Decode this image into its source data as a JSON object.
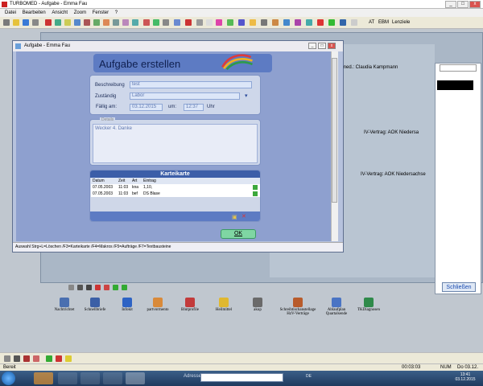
{
  "app": {
    "title": "TURBOMED - Aufgabe - Emma Fau",
    "menu": [
      "Datei",
      "Bearbeiten",
      "Ansicht",
      "Zoom",
      "Fenster",
      "?"
    ],
    "toolbar_text": [
      "AT",
      "EBM",
      "Lenziele"
    ]
  },
  "patient": {
    "doctor_label": "med.: Claudia Kampmann",
    "contract_1": "IV-Vertrag: AOK Niedersa",
    "contract_2": "IV-Vertrag: AOK Niedersachse",
    "close_button": "Schließen"
  },
  "dialog": {
    "window_title": "Aufgabe - Emma Fau",
    "heading": "Aufgabe erstellen",
    "form": {
      "beschreibung_label": "Beschreibung",
      "beschreibung_value": "test",
      "zustaendig_label": "Zuständig",
      "zustaendig_value": "Labor",
      "faellig_label": "Fällig am:",
      "faellig_date": "03.12.2015",
      "um_label": "um:",
      "faellig_time": "12:37",
      "uhr_label": "Uhr"
    },
    "details": {
      "legend": "Details",
      "text": "Wecker 4. Danke"
    },
    "karteikarte": {
      "title": "Karteikarte",
      "columns": [
        "Datum",
        "Zeit",
        "Art",
        "Eintrag"
      ],
      "rows": [
        {
          "datum": "07.05.2003",
          "zeit": "11:03",
          "art": "kna",
          "eintrag": "1,10,"
        },
        {
          "datum": "07.05.2003",
          "zeit": "11:03",
          "art": "bef",
          "eintrag": "DS Blase"
        }
      ]
    },
    "ok_label": "OK",
    "hint": "Auswahl Strg+L=Löschen /F3=Karteikarte /F4=Makros /F5=Aufträge /F7=Textbausteine"
  },
  "icon_row": [
    {
      "label": "Nachtrichtet",
      "icon": "doc-icon"
    },
    {
      "label": "Schnellbriefe",
      "icon": "letter-icon"
    },
    {
      "label": "Infokit",
      "icon": "info-icon"
    },
    {
      "label": "partvormento",
      "icon": "chart-icon"
    },
    {
      "label": "Blutprofile",
      "icon": "blood-icon"
    },
    {
      "label": "Heilmittel",
      "icon": "heal-icon"
    },
    {
      "label": "akup",
      "icon": "needle-icon"
    },
    {
      "label": "Schreibtischanstellage HzV-Verträge",
      "icon": "desk-icon"
    },
    {
      "label": "Ablaufplan Quartalsende",
      "icon": "plan-icon"
    },
    {
      "label": "TKDiagnosen",
      "icon": "diag-icon"
    }
  ],
  "status": {
    "left": "Bereit",
    "num": "NUM",
    "date": "Do 03.12.",
    "code": "00:03:03"
  },
  "taskbar": {
    "address_label": "Adresse",
    "lang": "DE",
    "time": "13:41",
    "date": "03.12.2015"
  },
  "colors": {
    "dialog_bg": "#8ea0cf",
    "header_band": "#5d7bc3",
    "ok_button": "#7fd6a3",
    "karteikarte_head": "#3c5ea8"
  }
}
